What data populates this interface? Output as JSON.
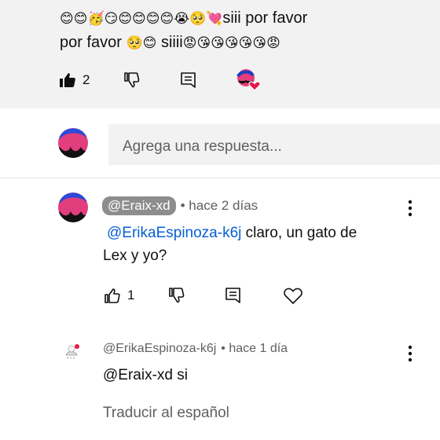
{
  "parent_comment": {
    "line1_emojis": "😊😊🥳😏😊😊😊😊😭🥺💘",
    "line1_text": "siii por favor",
    "line2_text_a": "por favor",
    "line2_emojis_a": "🥺😊",
    "line2_text_b": "siiii",
    "line2_emojis_b": "😡😘😘😘😘😘😡",
    "like_count": "2"
  },
  "reply_box": {
    "placeholder": "Agrega una respuesta..."
  },
  "reply1": {
    "author": "@Eraix-xd",
    "time": "• hace 2 días",
    "mention": "@ErikaEspinoza-k6j",
    "text_after_mention": " claro, un gato de",
    "text_line2": "Lex y yo?",
    "like_count": "1"
  },
  "reply2": {
    "author": "@ErikaEspinoza-k6j",
    "time": "• hace 1 día",
    "text": "@Eraix-xd  si",
    "translate_label": "Traducir al español"
  },
  "colors": {
    "mention": "#065fd4",
    "pill": "#8d8d8d",
    "top_background": "#f2f2f2",
    "heart": "#e8184a"
  }
}
